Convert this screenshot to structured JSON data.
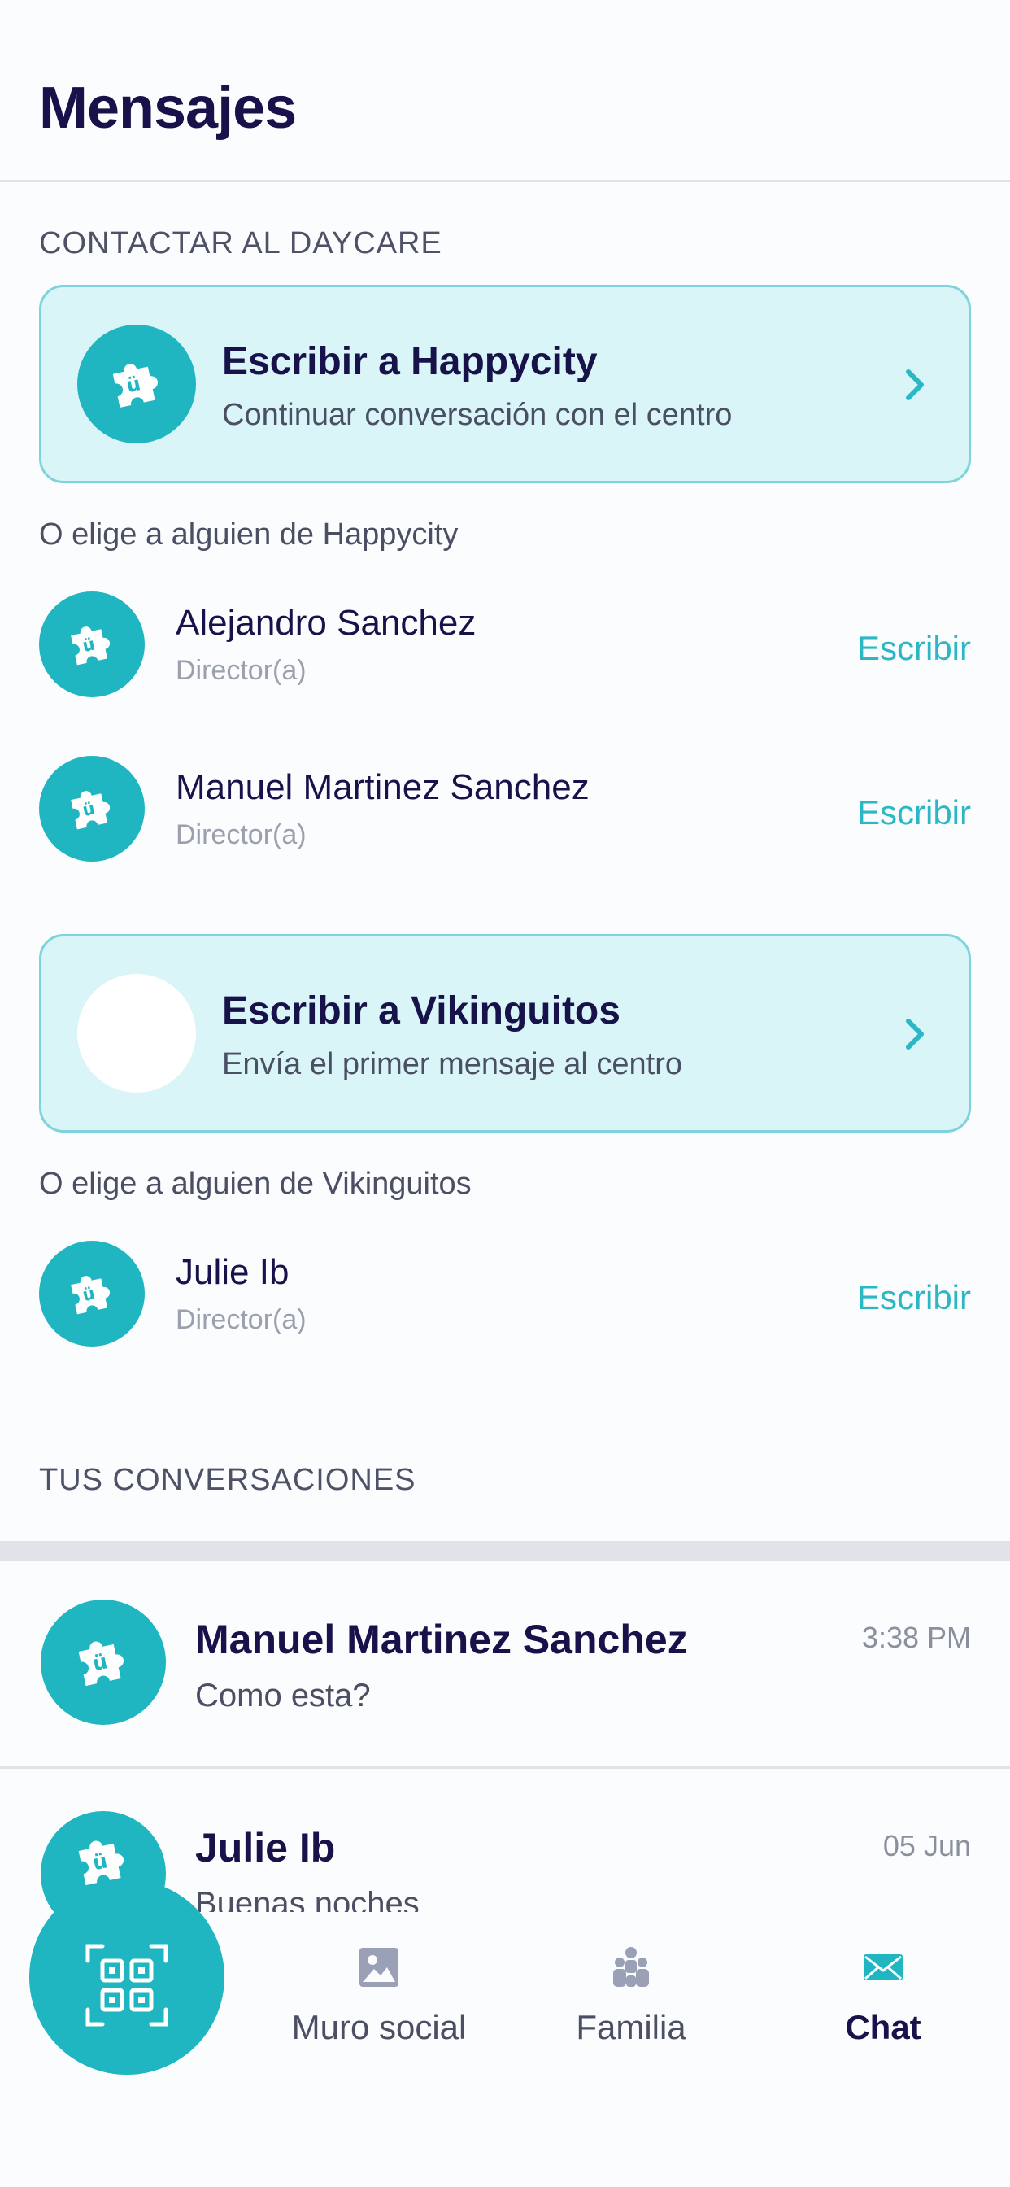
{
  "header": {
    "title": "Mensajes"
  },
  "contact_section": {
    "label": "CONTACTAR AL DAYCARE"
  },
  "centers": [
    {
      "title": "Escribir a Happycity",
      "subtitle": "Continuar conversación con el centro",
      "choose_label": "O elige a alguien de Happycity",
      "staff": [
        {
          "name": "Alejandro Sanchez",
          "role": "Director(a)",
          "action": "Escribir"
        },
        {
          "name": "Manuel Martinez Sanchez",
          "role": "Director(a)",
          "action": "Escribir"
        }
      ]
    },
    {
      "title": "Escribir a Vikinguitos",
      "subtitle": "Envía el primer mensaje al centro",
      "choose_label": "O elige a alguien de Vikinguitos",
      "staff": [
        {
          "name": "Julie Ib",
          "role": "Director(a)",
          "action": "Escribir"
        }
      ]
    }
  ],
  "conversations_section": {
    "label": "TUS CONVERSACIONES"
  },
  "conversations": [
    {
      "name": "Manuel Martinez Sanchez",
      "message": "Como esta?",
      "time": "3:38 PM"
    },
    {
      "name": "Julie Ib",
      "message": "Buenas noches",
      "time": "05 Jun"
    }
  ],
  "tabbar": {
    "items": [
      {
        "label": "Muro social",
        "icon": "image-icon"
      },
      {
        "label": "Familia",
        "icon": "family-icon"
      },
      {
        "label": "Chat",
        "icon": "mail-icon",
        "active": true
      }
    ],
    "fab_icon": "qr-code-icon"
  },
  "colors": {
    "accent": "#1fb5c1",
    "accent_text": "#2bb7c3",
    "card_bg": "#d9f5f8",
    "title": "#17134a"
  }
}
